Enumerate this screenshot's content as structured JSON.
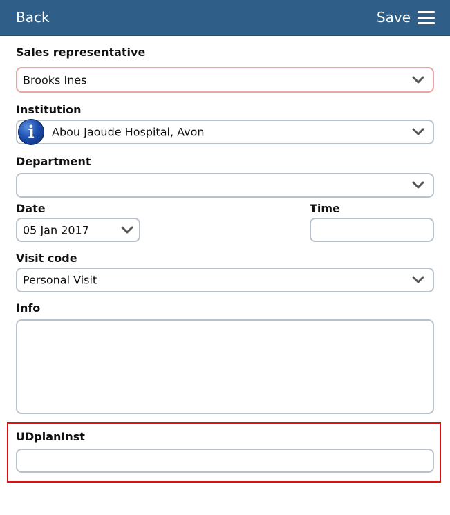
{
  "header": {
    "back_label": "Back",
    "save_label": "Save",
    "menu_icon": "hamburger-menu-icon",
    "background": "#2f5f88"
  },
  "form": {
    "sales_rep": {
      "label": "Sales representative",
      "value": "Brooks Ines"
    },
    "institution": {
      "label": "Institution",
      "value": "Abou Jaoude Hospital, Avon",
      "icon": "info-icon",
      "icon_glyph": "i"
    },
    "department": {
      "label": "Department",
      "value": ""
    },
    "date": {
      "label": "Date",
      "value": "05 Jan 2017"
    },
    "time": {
      "label": "Time",
      "value": ""
    },
    "visit_code": {
      "label": "Visit code",
      "value": "Personal Visit"
    },
    "info": {
      "label": "Info",
      "value": ""
    },
    "udplaninst": {
      "label": "UDplanInst",
      "value": ""
    }
  },
  "colors": {
    "field_border": "#b9c2cc",
    "invalid_border": "#e7a6a6",
    "highlight": "#e01010"
  }
}
